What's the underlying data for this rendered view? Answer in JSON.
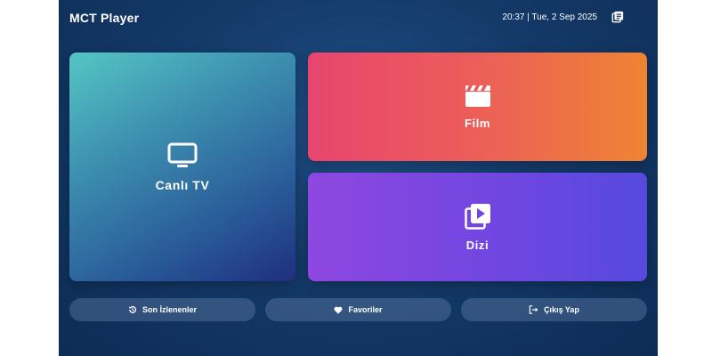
{
  "header": {
    "app_title": "MCT Player",
    "datetime": "20:37 | Tue, 2 Sep 2025",
    "library_icon": "library-icon"
  },
  "cards": {
    "live_tv": {
      "label": "Canlı TV",
      "icon": "tv-icon"
    },
    "film": {
      "label": "Film",
      "icon": "clapperboard-icon"
    },
    "series": {
      "label": "Dizi",
      "icon": "video-library-icon"
    }
  },
  "bottom_bar": {
    "recent": {
      "label": "Son İzlenenler",
      "icon": "history-icon"
    },
    "favorites": {
      "label": "Favoriler",
      "icon": "heart-icon"
    },
    "logout": {
      "label": "Çıkış Yap",
      "icon": "logout-icon"
    }
  },
  "colors": {
    "background": "#143a69",
    "tv_card_start": "#55c6c4",
    "tv_card_end": "#1f2f7e",
    "film_card_start": "#e8456f",
    "film_card_end": "#ee8433",
    "series_card_start": "#8e47e0",
    "series_card_end": "#5649df"
  }
}
